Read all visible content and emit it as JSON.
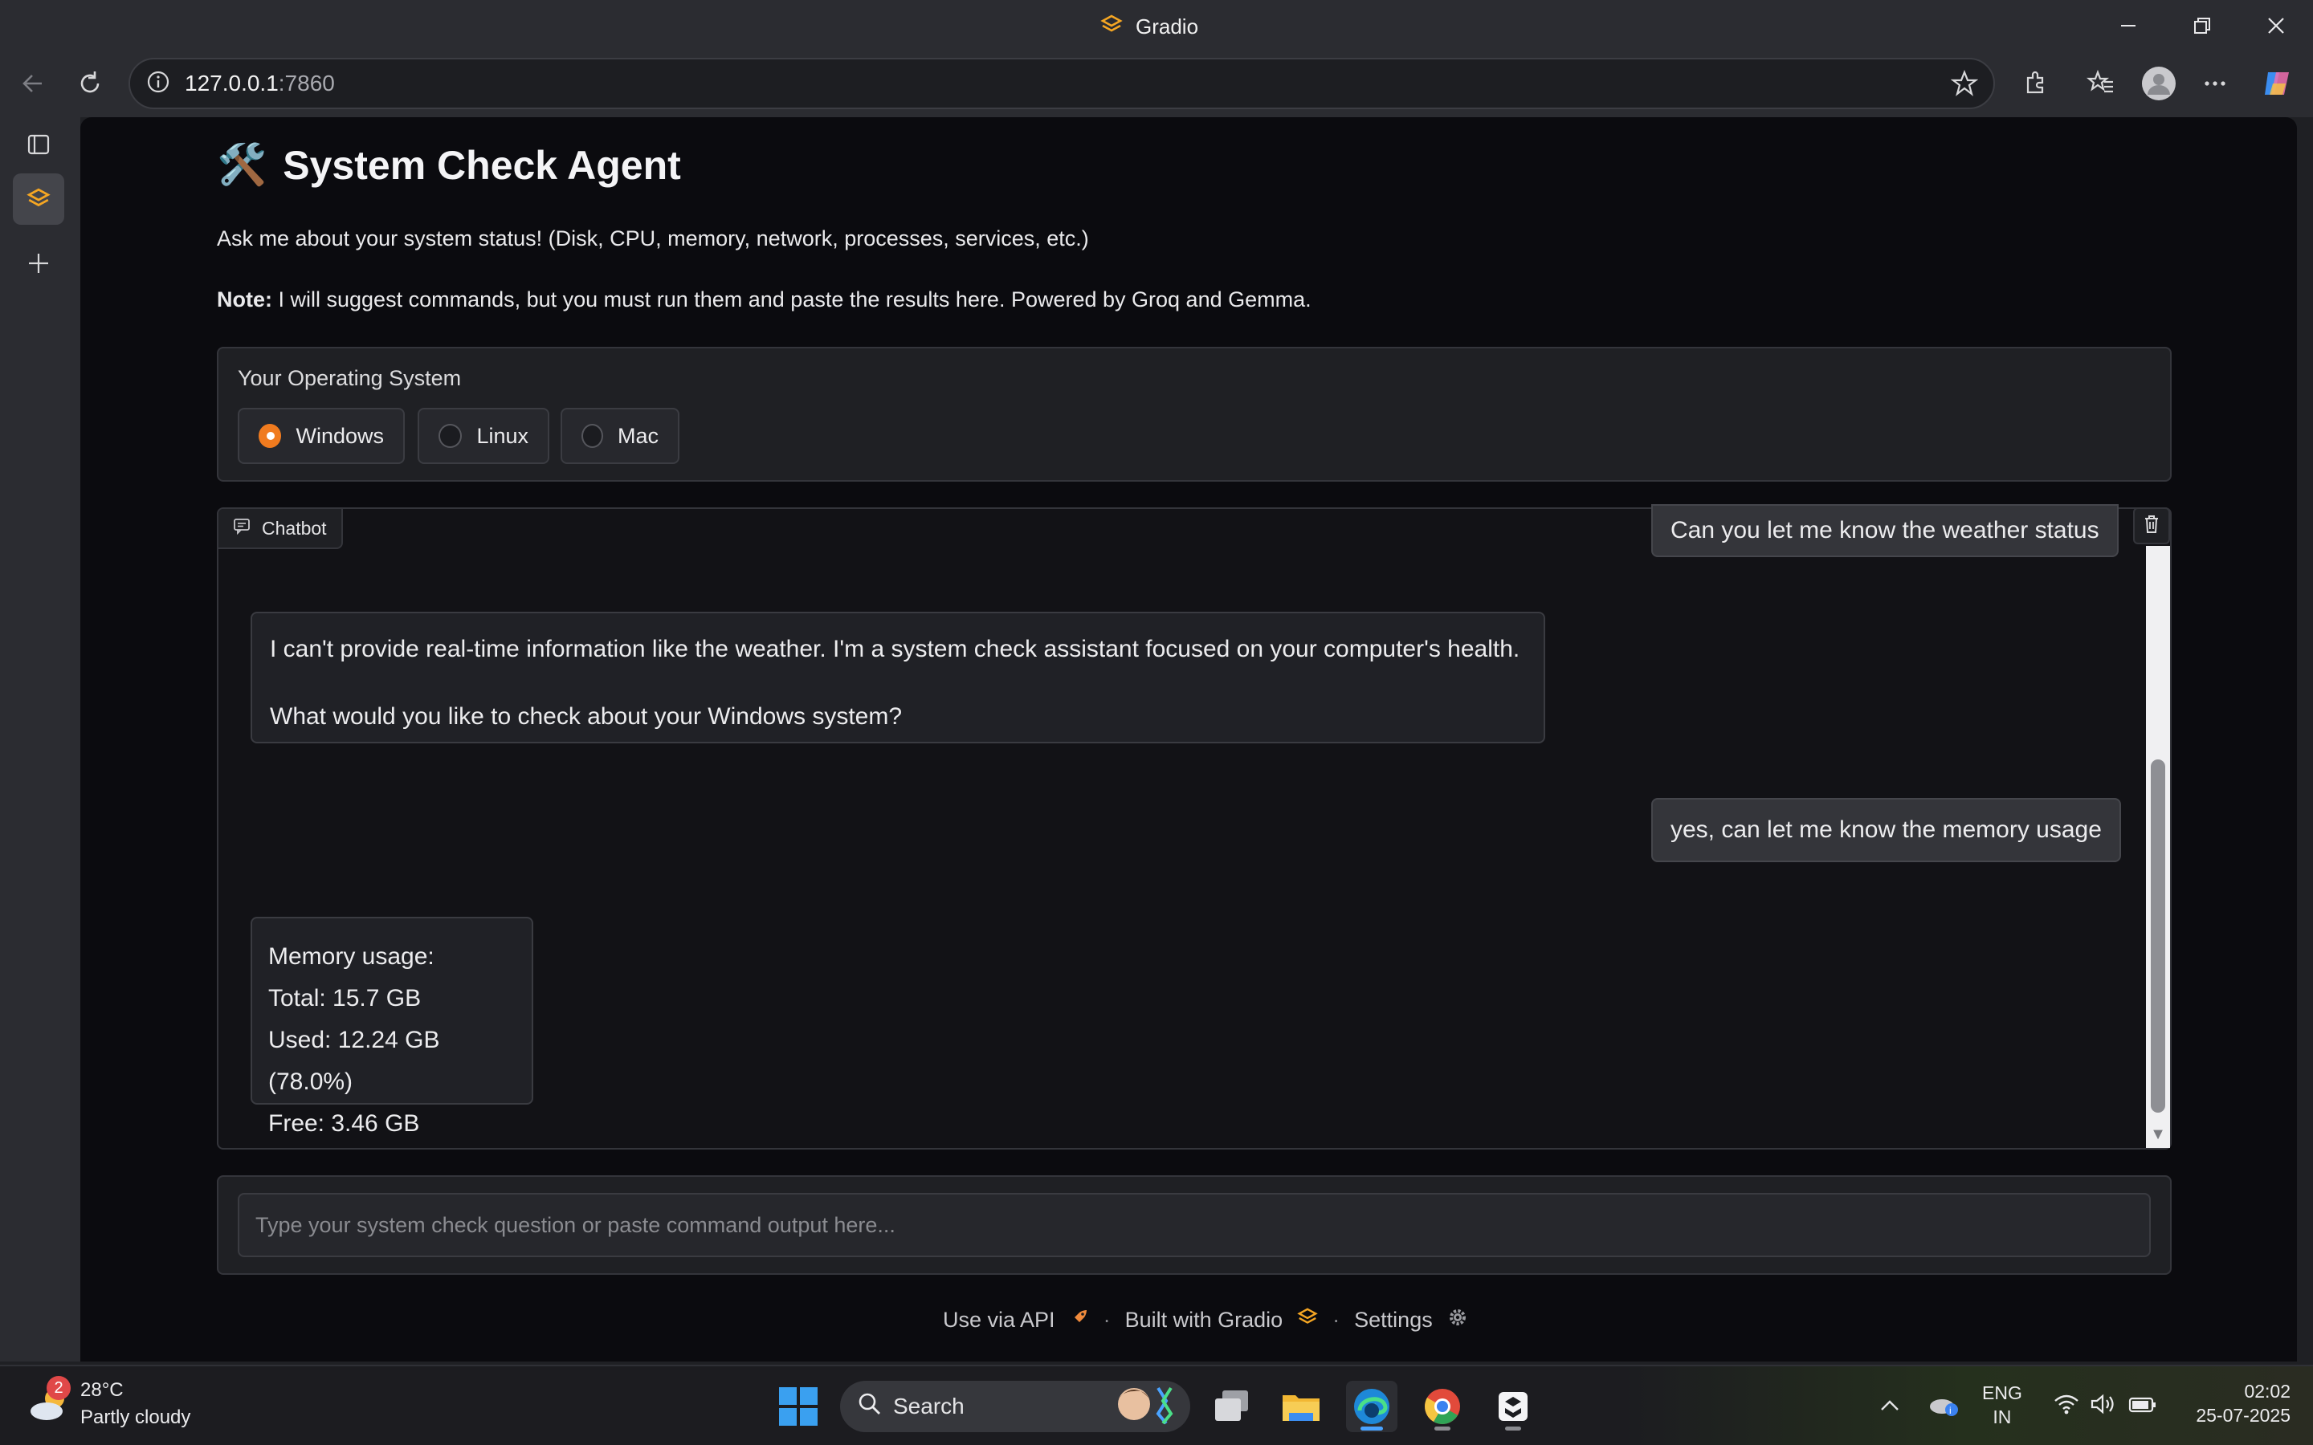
{
  "window": {
    "title": "Gradio",
    "controls": [
      "minimize-icon",
      "restore-icon",
      "close-icon"
    ]
  },
  "browser": {
    "url_host": "127.0.0.1",
    "url_port": ":7860",
    "toolbar_icons": [
      "back-icon",
      "refresh-icon",
      "info-icon",
      "star-icon",
      "extensions-icon",
      "favorites-icon",
      "profile-icon",
      "more-icon",
      "copilot-icon"
    ],
    "vertical_tabs": [
      "tab-actions-icon",
      "gradio-tab-icon",
      "new-tab-icon"
    ]
  },
  "app": {
    "title_icon": "🛠️",
    "title": "System Check Agent",
    "description": "Ask me about your system status! (Disk, CPU, memory, network, processes, services, etc.)",
    "note_label": "Note:",
    "note_text": " I will suggest commands, but you must run them and paste the results here. Powered by Groq and Gemma."
  },
  "os_selector": {
    "label": "Your Operating System",
    "options": [
      {
        "label": "Windows",
        "selected": true
      },
      {
        "label": "Linux",
        "selected": false
      },
      {
        "label": "Mac",
        "selected": false
      }
    ],
    "accent_color": "#f07b1f"
  },
  "chatbot": {
    "label": "Chatbot",
    "messages": [
      {
        "role": "user",
        "text": "Can you let me know the weather status"
      },
      {
        "role": "assistant",
        "lines": [
          "I can't provide real-time information like the weather. I'm a system check assistant focused on your computer's health.",
          "What would you like to check about your Windows system?"
        ]
      },
      {
        "role": "user",
        "text": "yes, can let me know the memory usage"
      },
      {
        "role": "assistant",
        "lines": [
          "Memory usage:",
          "Total: 15.7 GB",
          "Used: 12.24 GB (78.0%)",
          "Free: 3.46 GB"
        ]
      }
    ]
  },
  "input": {
    "placeholder": "Type your system check question or paste command output here...",
    "value": ""
  },
  "footer": {
    "api_label": "Use via API",
    "built_label": "Built with Gradio",
    "settings_label": "Settings",
    "separator": "·"
  },
  "taskbar": {
    "weather_badge": "2",
    "weather_temp": "28°C",
    "weather_desc": "Partly cloudy",
    "search_label": "Search",
    "apps": [
      "task-view-icon",
      "file-explorer-icon",
      "edge-icon",
      "chrome-icon",
      "app-icon"
    ],
    "lang_line1": "ENG",
    "lang_line2": "IN",
    "time": "02:02",
    "date": "25-07-2025"
  }
}
